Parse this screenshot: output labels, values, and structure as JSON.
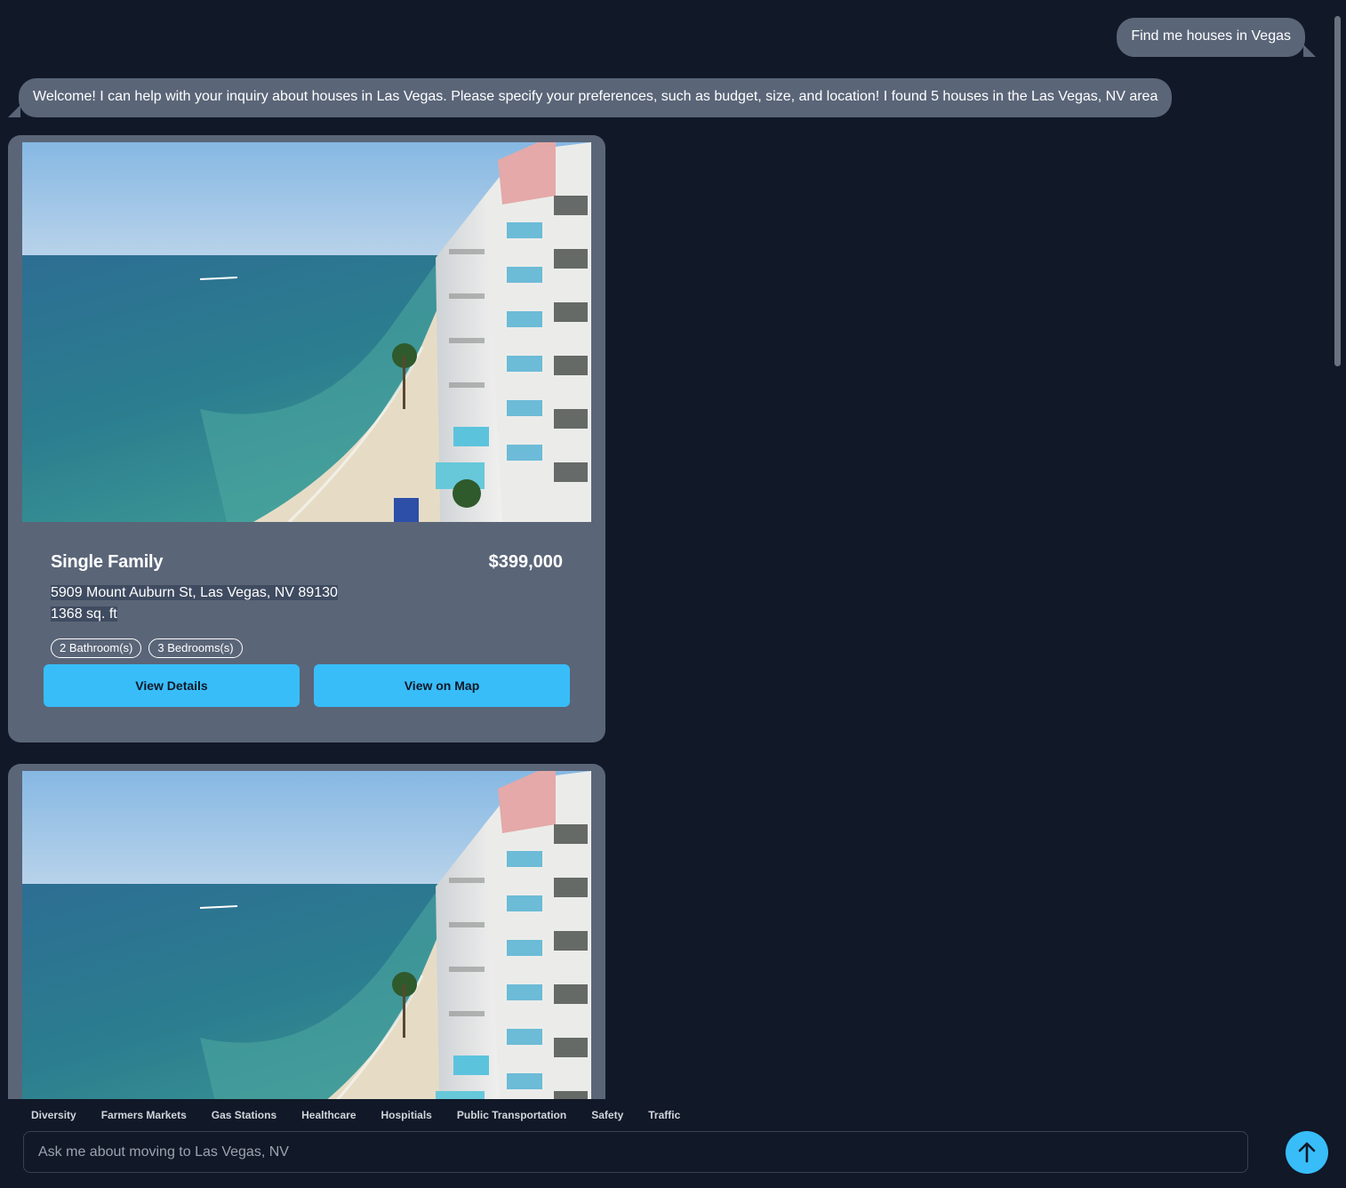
{
  "chat": {
    "user_message": "Find me houses in Vegas",
    "bot_message": "Welcome! I can help with your inquiry about houses in Las Vegas. Please specify your preferences, such as budget, size, and location! I found 5 houses in the Las Vegas, NV area"
  },
  "listings": [
    {
      "type": "Single Family",
      "price": "$399,000",
      "address": "5909 Mount Auburn St, Las Vegas, NV 89130",
      "sqft": "1368 sq. ft",
      "bathrooms": "2 Bathroom(s)",
      "bedrooms": "3 Bedrooms(s)",
      "details_label": "View Details",
      "map_label": "View on Map",
      "image": "beach-highrise-photo"
    },
    {
      "image": "beach-highrise-photo"
    }
  ],
  "chips": [
    "Diversity",
    "Farmers Markets",
    "Gas Stations",
    "Healthcare",
    "Hospitials",
    "Public Transportation",
    "Safety",
    "Traffic"
  ],
  "composer": {
    "placeholder": "Ask me about moving to Las Vegas, NV",
    "send_icon": "arrow-up-icon"
  },
  "colors": {
    "background": "#111827",
    "bubble": "#5a6578",
    "accent": "#38bdf8"
  }
}
